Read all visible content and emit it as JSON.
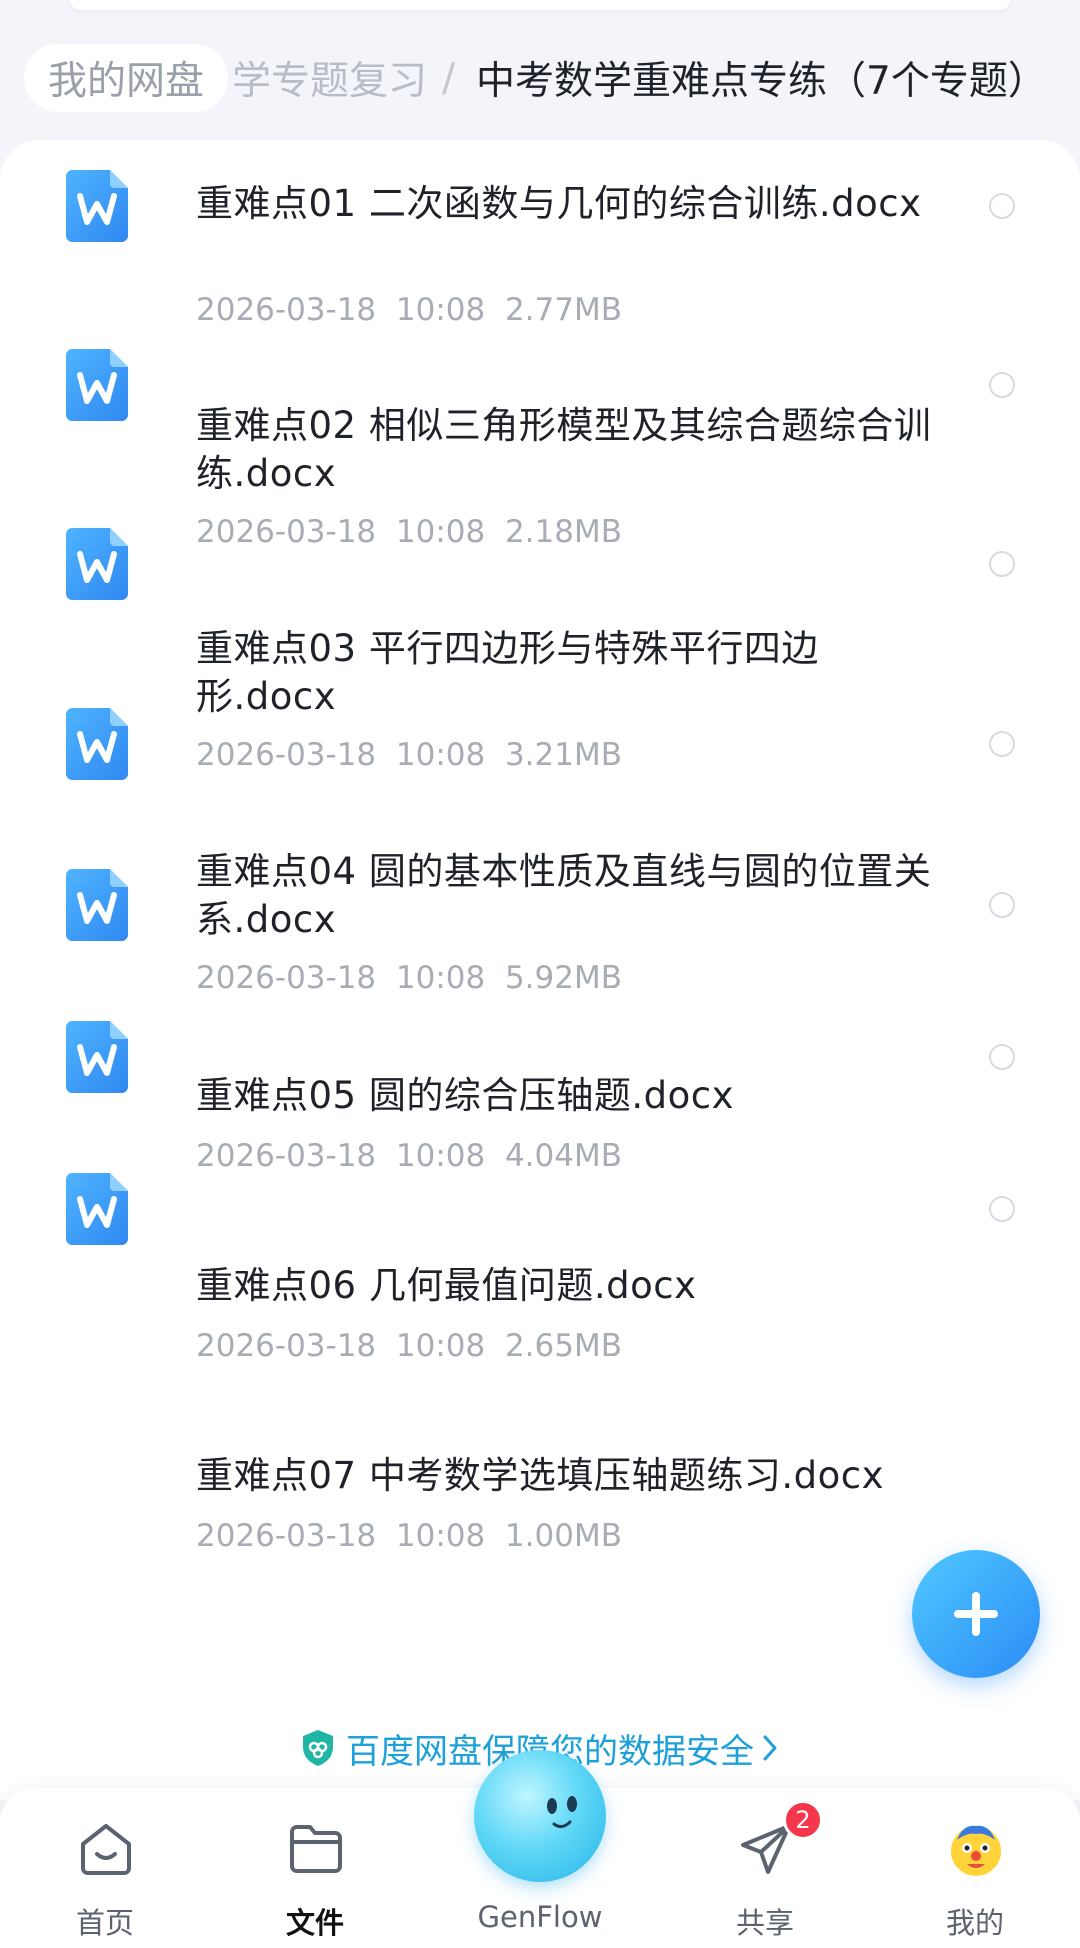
{
  "breadcrumb": {
    "root": "我的网盘",
    "middle": "学专题复习",
    "separator": "/",
    "current": "中考数学重难点专练（7个专题）"
  },
  "files": [
    {
      "name": "重难点01 二次函数与几何的综合训练.docx",
      "date": "2026-03-18",
      "time": "10:08",
      "size": "2.77MB",
      "icon": "word-docx-icon"
    },
    {
      "name": "重难点02 相似三角形模型及其综合题综合训练.docx",
      "date": "2026-03-18",
      "time": "10:08",
      "size": "2.18MB",
      "icon": "word-docx-icon"
    },
    {
      "name": "重难点03 平行四边形与特殊平行四边形.docx",
      "date": "2026-03-18",
      "time": "10:08",
      "size": "3.21MB",
      "icon": "word-docx-icon"
    },
    {
      "name": "重难点04 圆的基本性质及直线与圆的位置关系.docx",
      "date": "2026-03-18",
      "time": "10:08",
      "size": "5.92MB",
      "icon": "word-docx-icon"
    },
    {
      "name": "重难点05 圆的综合压轴题.docx",
      "date": "2026-03-18",
      "time": "10:08",
      "size": "4.04MB",
      "icon": "word-docx-icon"
    },
    {
      "name": "重难点06 几何最值问题.docx",
      "date": "2026-03-18",
      "time": "10:08",
      "size": "2.65MB",
      "icon": "word-docx-icon"
    },
    {
      "name": "重难点07 中考数学选填压轴题练习.docx",
      "date": "2026-03-18",
      "time": "10:08",
      "size": "1.00MB",
      "icon": "word-docx-icon"
    }
  ],
  "safety_banner": {
    "text": "百度网盘保障您的数据安全",
    "icon": "shield-icon"
  },
  "fab": {
    "icon": "plus-icon"
  },
  "tabbar": {
    "home": {
      "label": "首页",
      "icon": "home-icon"
    },
    "files": {
      "label": "文件",
      "icon": "folder-icon"
    },
    "genflow": {
      "label": "GenFlow",
      "icon": "genflow-orb-icon"
    },
    "share": {
      "label": "共享",
      "icon": "paper-plane-icon",
      "badge": "2"
    },
    "mine": {
      "label": "我的",
      "icon": "avatar-icon"
    }
  },
  "colors": {
    "accent": "#2b8cf5",
    "badge": "#f5364b",
    "banner": "#1ea0d9"
  }
}
